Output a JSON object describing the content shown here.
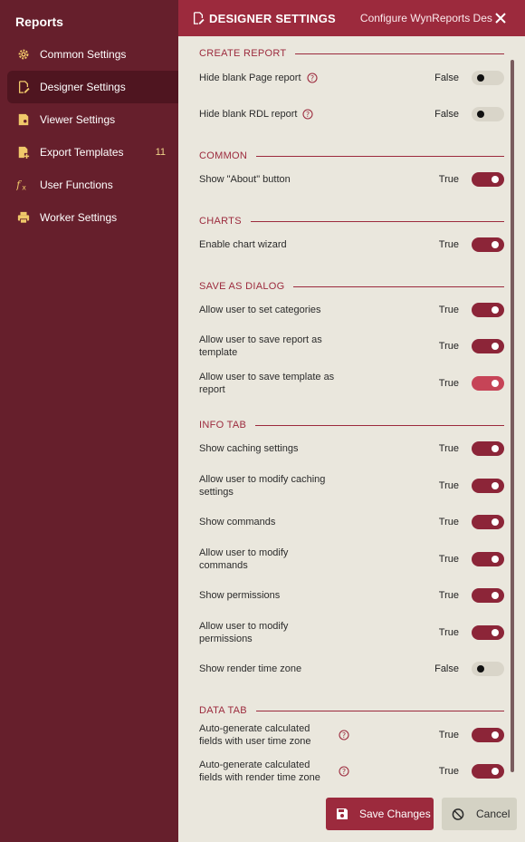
{
  "sidebar": {
    "title": "Reports",
    "items": [
      {
        "label": "Common Settings",
        "icon": "gear-icon",
        "badge": ""
      },
      {
        "label": "Designer Settings",
        "icon": "designer-edit-icon",
        "badge": ""
      },
      {
        "label": "Viewer Settings",
        "icon": "viewer-document-icon",
        "badge": ""
      },
      {
        "label": "Export Templates",
        "icon": "export-add-icon",
        "badge": "11"
      },
      {
        "label": "User Functions",
        "icon": "function-fx-icon",
        "badge": ""
      },
      {
        "label": "Worker Settings",
        "icon": "printer-icon",
        "badge": ""
      }
    ]
  },
  "header": {
    "title": "DESIGNER SETTINGS",
    "subtitle": "Configure WynReports Des..."
  },
  "sections": {
    "create_report": "CREATE REPORT",
    "common": "COMMON",
    "charts": "CHARTS",
    "save_as_dialog": "SAVE AS DIALOG",
    "info_tab": "INFO TAB",
    "data_tab": "DATA TAB"
  },
  "settings": {
    "hide_blank_page": {
      "label": "Hide blank Page report",
      "value": "False",
      "on": false
    },
    "hide_blank_rdl": {
      "label": "Hide blank RDL report",
      "value": "False",
      "on": false
    },
    "show_about": {
      "label": "Show \"About\" button",
      "value": "True",
      "on": true
    },
    "chart_wizard": {
      "label": "Enable chart wizard",
      "value": "True",
      "on": true
    },
    "set_categories": {
      "label": "Allow user to set categories",
      "value": "True",
      "on": true
    },
    "save_as_template": {
      "label": "Allow user to save report as template",
      "value": "True",
      "on": true
    },
    "save_template_as_report": {
      "label": "Allow user to save template as report",
      "value": "True",
      "on": true
    },
    "show_caching": {
      "label": "Show caching settings",
      "value": "True",
      "on": true
    },
    "modify_caching": {
      "label": "Allow user to modify caching settings",
      "value": "True",
      "on": true
    },
    "show_commands": {
      "label": "Show commands",
      "value": "True",
      "on": true
    },
    "modify_commands": {
      "label": "Allow user to modify commands",
      "value": "True",
      "on": true
    },
    "show_permissions": {
      "label": "Show permissions",
      "value": "True",
      "on": true
    },
    "modify_permissions": {
      "label": "Allow user to modify permissions",
      "value": "True",
      "on": true
    },
    "render_time_zone": {
      "label": "Show render time zone",
      "value": "False",
      "on": false
    },
    "auto_user_tz": {
      "label": "Auto-generate calculated fields with user time zone",
      "value": "True",
      "on": true
    },
    "auto_render_tz": {
      "label": "Auto-generate calculated fields with render time zone",
      "value": "True",
      "on": true
    }
  },
  "footer": {
    "save_label": "Save Changes",
    "cancel_label": "Cancel"
  },
  "colors": {
    "sidebar": "#661f2c",
    "header": "#9c2a3d",
    "panel": "#eae7dd",
    "toggle_on": "#8c2538",
    "toggle_off": "#d9d5c9"
  }
}
